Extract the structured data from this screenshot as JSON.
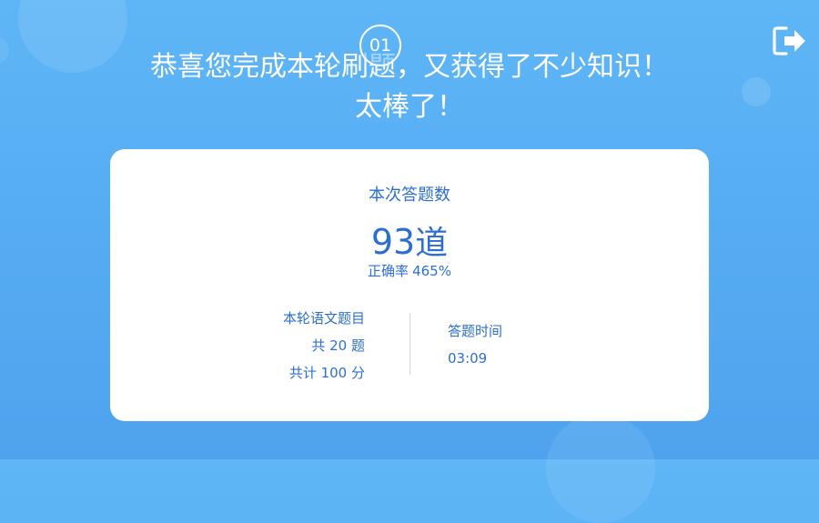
{
  "header": {
    "step_number": "01",
    "line1": "恭喜您完成本轮刷题，又获得了不少知识！",
    "line2": "太棒了！",
    "exit_icon": "exit-icon"
  },
  "card": {
    "title": "本次答题数",
    "count": "93",
    "count_unit": "道",
    "accuracy_label": "正确率",
    "accuracy_value": "465%",
    "left": {
      "subject": "本轮语文题目",
      "total_questions": "共 20 题",
      "total_score": "共计 100 分"
    },
    "right": {
      "time_label": "答题时间",
      "time_value": "03:09"
    }
  },
  "colors": {
    "background": "#56acf2",
    "accent_text": "#2d6fd0",
    "card": "#ffffff"
  }
}
